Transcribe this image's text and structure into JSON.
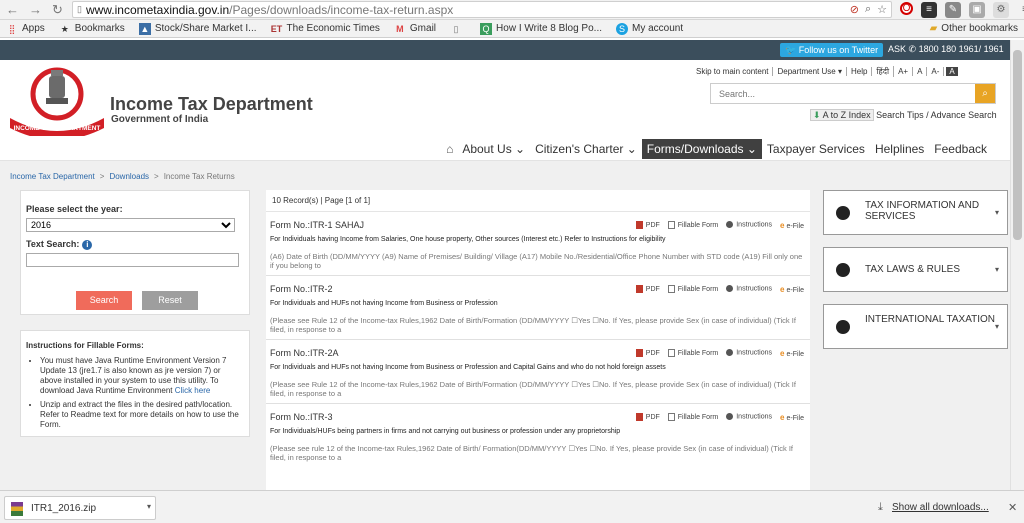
{
  "browser": {
    "url_host": "www.incometaxindia.gov.in",
    "url_path": "/Pages/downloads/income-tax-return.aspx",
    "bookmarks": [
      "Apps",
      "Bookmarks",
      "Stock/Share Market I...",
      "The Economic Times",
      "Gmail",
      "",
      "How I Write 8 Blog Po...",
      "My account"
    ],
    "other_bookmarks": "Other bookmarks"
  },
  "topstrip": {
    "twitter": "Follow us on Twitter",
    "ask": "ASK",
    "phone": "1800 180 1961/ 1961"
  },
  "header": {
    "title": "Income Tax Department",
    "subtitle": "Government of India",
    "emblem_text": "INCOME TAX DEPARTMENT",
    "util_links": [
      "Skip to main content",
      "Department Use ▾",
      "Help",
      "हिंदी",
      "A+",
      "A",
      "A-"
    ],
    "util_dark": "A",
    "search_placeholder": "Search...",
    "az_badge": "A to Z Index",
    "az_text": "Search Tips / Advance Search"
  },
  "nav": {
    "items": [
      "About Us ⌄",
      "Citizen's Charter ⌄",
      "Forms/Downloads ⌄",
      "Taxpayer Services",
      "Helplines",
      "Feedback"
    ]
  },
  "breadcrumb": {
    "home": "Income Tax Department",
    "downloads": "Downloads",
    "current": "Income Tax Returns"
  },
  "filter": {
    "year_label": "Please select the year:",
    "year_value": "2016",
    "text_label": "Text Search:",
    "search_btn": "Search",
    "reset_btn": "Reset"
  },
  "instructions": {
    "heading": "Instructions for Fillable Forms:",
    "item1": "You must have Java Runtime Environment Version 7 Update 13 (jre1.7 is also known as jre version 7) or above installed in your system to use this utility. To download Java Runtime Environment",
    "item1_link": "Click here",
    "item2": "Unzip and extract the files in the desired path/location. Refer to Readme text for more details on how to use the Form."
  },
  "records": {
    "header": "10 Record(s) | Page [1 of 1]",
    "link_labels": [
      "PDF",
      "Fillable Form",
      "Instructions",
      "e-File"
    ],
    "forms": [
      {
        "title": "Form No.:ITR-1 SAHAJ",
        "desc": "For Individuals having Income from Salaries, One house property, Other sources (Interest etc.) Refer to Instructions for eligibility",
        "note": "(A6) Date of Birth (DD/MM/YYYY (A9) Name of Premises/ Building/ Village (A17) Mobile No./Residential/Office Phone Number with STD code (A19) Fill only one if you belong to"
      },
      {
        "title": "Form No.:ITR-2",
        "desc": "For Individuals and HUFs not having Income from Business or Profession",
        "note": "(Please see Rule 12 of the Income-tax Rules,1962 Date of Birth/Formation (DD/MM/YYYY ☐Yes ☐No. If Yes, please provide Sex (in case of individual) (Tick If filed, in response to a"
      },
      {
        "title": "Form No.:ITR-2A",
        "desc": "For Individuals and HUFs not having Income from Business or Profession and Capital Gains and who do not hold foreign assets",
        "note": "(Please see Rule 12 of the Income-tax Rules,1962 Date of Birth/Formation (DD/MM/YYYY ☐Yes ☐No. If Yes, please provide Sex (in case of individual) (Tick If filed, in response to a"
      },
      {
        "title": "Form No.:ITR-3",
        "desc": "For Individuals/HUFs being partners in firms and not carrying out business or profession under any proprietorship",
        "note": "(Please see rule 12 of the Income-tax Rules,1962 Date of Birth/ Formation(DD/MM/YYYY ☐Yes ☐No. If Yes, please provide Sex (in case of individual) (Tick If filed, in response to a"
      }
    ]
  },
  "side": {
    "items": [
      "TAX INFORMATION AND SERVICES",
      "TAX LAWS & RULES",
      "INTERNATIONAL TAXATION"
    ]
  },
  "downloads": {
    "file": "ITR1_2016.zip",
    "show_all": "Show all downloads..."
  }
}
